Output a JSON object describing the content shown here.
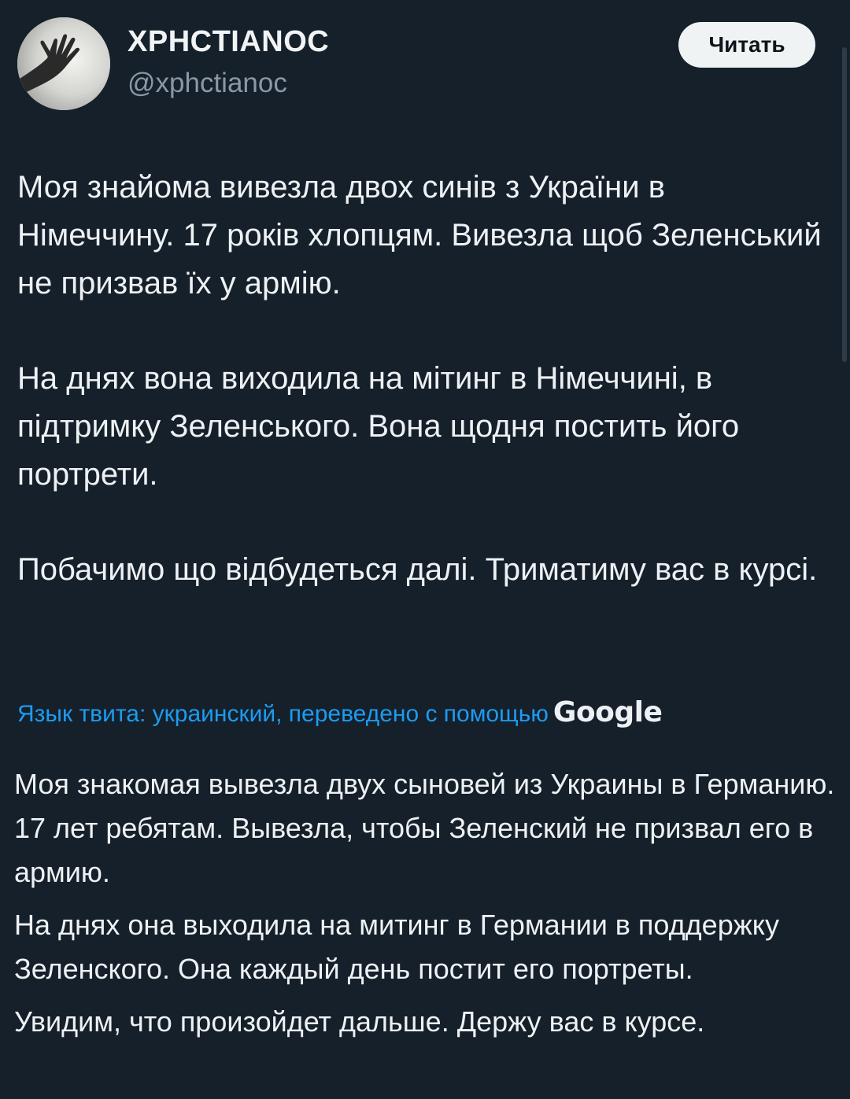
{
  "author": {
    "display_name": "ΧΡΗCΤΙΑΝΟC",
    "handle": "@xphctianoc",
    "avatar_icon": "hand-avatar-icon"
  },
  "actions": {
    "follow_label": "Читать"
  },
  "tweet": {
    "paragraphs": [
      "Моя знайома вивезла двох синів з України в Німеччину. 17 років хлопцям. Вивезла щоб Зеленський не призвав їх у армію.",
      "На днях вона виходила на мітинг в Німеччині, в підтримку Зеленського. Вона щодня постить його портрети.",
      "Побачимо що відбудеться далі. Триматиму вас в курсі."
    ]
  },
  "translation": {
    "note": "Язык твита: украинский, переведено с помощью",
    "provider": "Google",
    "paragraphs": [
      "Моя знакомая вывезла двух сыновей из Украины в Германию. 17 лет ребятам. Вывезла, чтобы Зеленский не призвал его в армию.",
      "На днях она выходила на митинг в Германии в поддержку Зеленского. Она каждый день постит его портреты.",
      "Увидим, что произойдет дальше. Держу вас в курсе."
    ]
  },
  "colors": {
    "background": "#15202b",
    "link": "#1d9bf0",
    "text": "#eef1f3",
    "secondary_text": "#8b98a5",
    "button_bg": "#eff3f4"
  }
}
